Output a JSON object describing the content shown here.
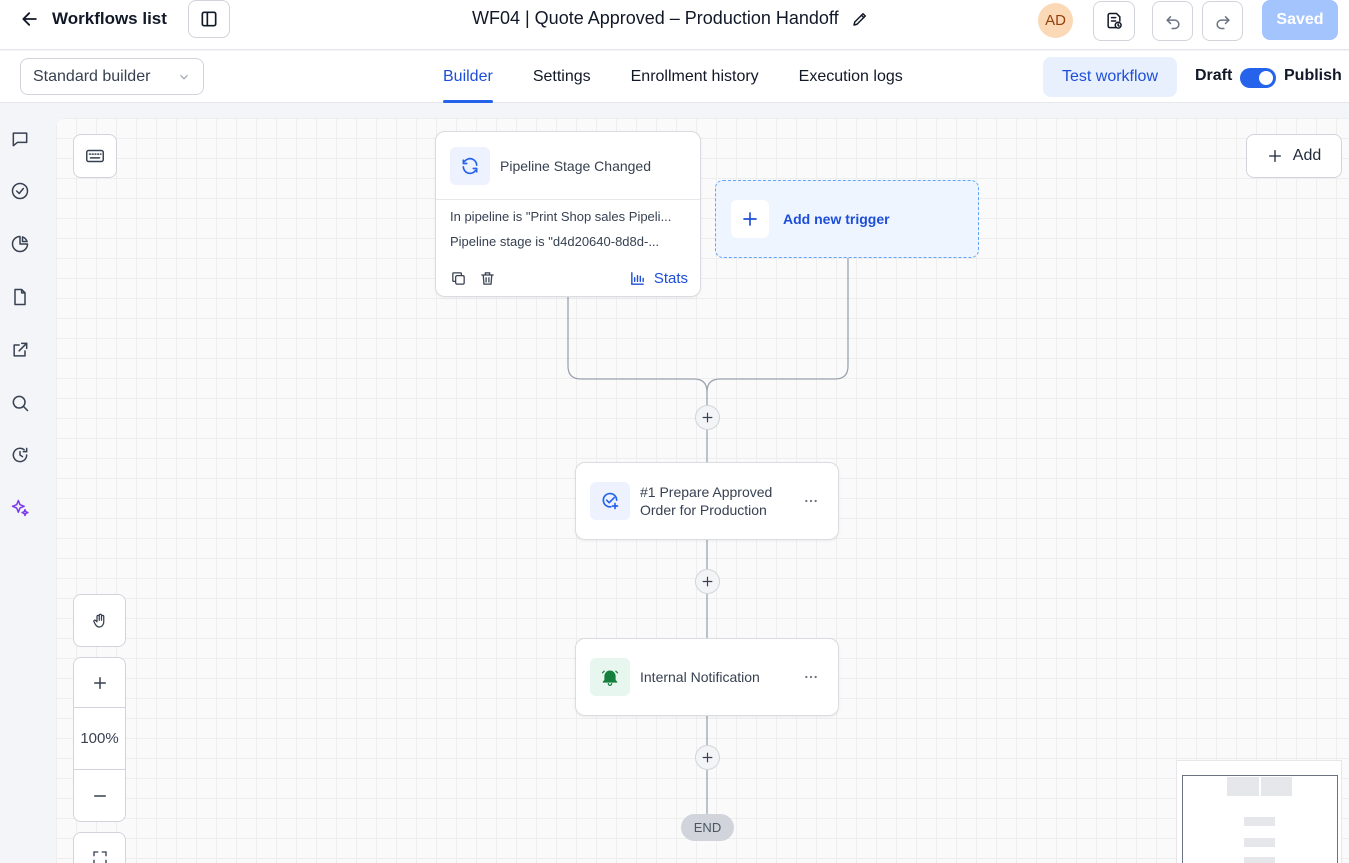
{
  "header": {
    "back_label": "Workflows list",
    "title": "WF04 | Quote Approved – Production Handoff",
    "avatar_initials": "AD",
    "saved_label": "Saved"
  },
  "subbar": {
    "builder_mode": "Standard builder",
    "tabs": [
      {
        "label": "Builder",
        "active": true
      },
      {
        "label": "Settings",
        "active": false
      },
      {
        "label": "Enrollment history",
        "active": false
      },
      {
        "label": "Execution logs",
        "active": false
      }
    ],
    "test_label": "Test workflow",
    "draft_label": "Draft",
    "publish_label": "Publish",
    "publish_on": true
  },
  "left_rail": {
    "icons": [
      "chat-icon",
      "check-circle-icon",
      "pie-chart-icon",
      "document-icon",
      "external-link-icon",
      "search-icon",
      "history-icon",
      "sparkles-icon"
    ]
  },
  "canvas": {
    "add_label": "Add",
    "trigger": {
      "name": "Pipeline Stage Changed",
      "conditions": [
        "In pipeline is \"Print Shop sales Pipeli...",
        "Pipeline stage is \"d4d20640-8d8d-..."
      ],
      "stats_label": "Stats"
    },
    "new_trigger_label": "Add new trigger",
    "actions": [
      {
        "label": "#1 Prepare Approved Order for Production",
        "icon": "check-plus-icon"
      },
      {
        "label": "Internal Notification",
        "icon": "bell-icon"
      }
    ],
    "end_label": "END"
  },
  "zoom": {
    "level": "100%"
  },
  "colors": {
    "accent": "#2563eb",
    "saved_button": "#a3c4fd",
    "notification_icon": "#15803d"
  }
}
